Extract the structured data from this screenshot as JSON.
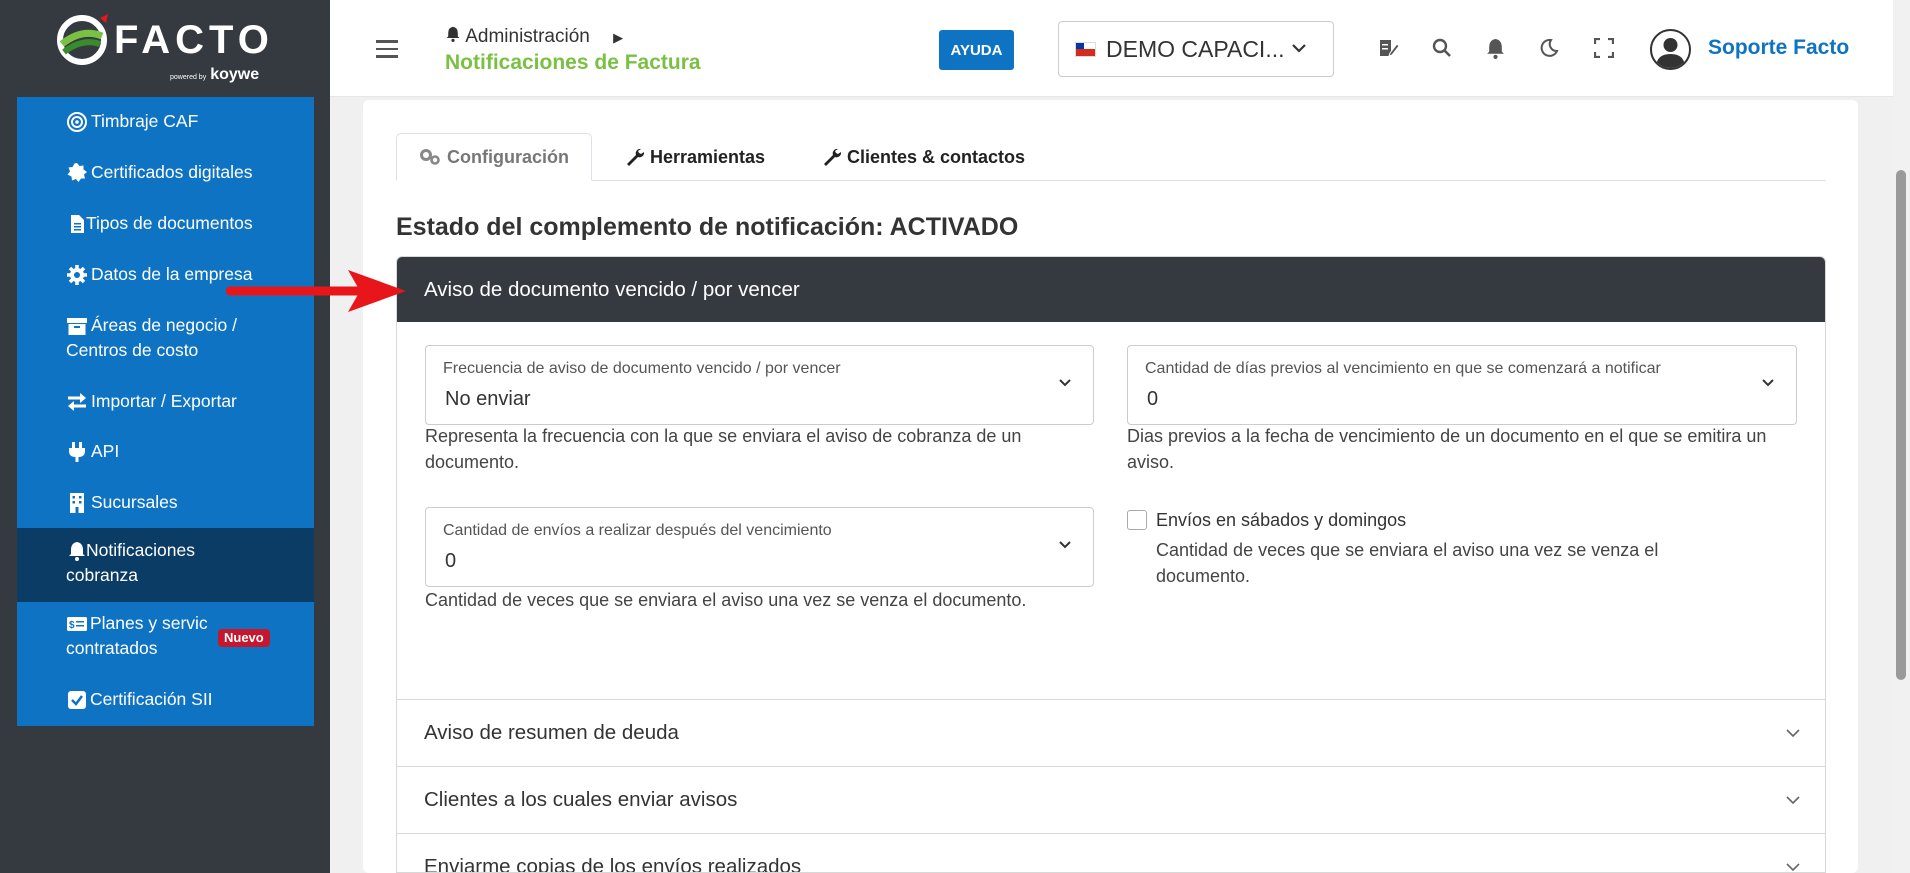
{
  "brand": {
    "name": "FACTO",
    "powered_small": "powered by",
    "powered": "koywe"
  },
  "sidebar": {
    "items": [
      {
        "label": "Timbraje CAF",
        "icon": "target-icon"
      },
      {
        "label": "Certificados digitales",
        "icon": "seal-icon"
      },
      {
        "label": "Tipos de documentos",
        "icon": "file-icon"
      },
      {
        "label": "Datos de la empresa",
        "icon": "gear-icon"
      },
      {
        "label": "Áreas de negocio /",
        "label2": "Centros de costo",
        "icon": "archive-icon"
      },
      {
        "label": "Importar / Exportar",
        "icon": "exchange-icon"
      },
      {
        "label": "API",
        "icon": "plug-icon"
      },
      {
        "label": "Sucursales",
        "icon": "building-icon"
      },
      {
        "label": "Notificaciones",
        "label2": "cobranza",
        "icon": "bell-icon",
        "active": true
      },
      {
        "label": "Planes y servic",
        "label2": "contratados",
        "icon": "money-icon",
        "badge": "Nuevo"
      },
      {
        "label": "Certificación SII",
        "icon": "check-square-icon"
      }
    ]
  },
  "header": {
    "breadcrumb_parent": "Administración",
    "page_title": "Notificaciones de Factura",
    "help_label": "AYUDA",
    "company": "DEMO CAPACI...",
    "user_name": "Soporte Facto"
  },
  "tabs": [
    {
      "label": "Configuración",
      "active": true
    },
    {
      "label": "Herramientas"
    },
    {
      "label": "Clientes & contactos"
    }
  ],
  "status_heading": "Estado del complemento de notificación: ACTIVADO",
  "panel": {
    "title": "Aviso de documento vencido / por vencer",
    "freq": {
      "label": "Frecuencia de aviso de documento vencido / por vencer",
      "value": "No enviar",
      "help": "Representa la frecuencia con la que se enviara el aviso de cobranza de un documento."
    },
    "days_before": {
      "label": "Cantidad de días previos al vencimiento en que se comenzará a notificar",
      "value": "0",
      "help": "Dias previos a la fecha de vencimiento de un documento en el que se emitira un aviso."
    },
    "sends_after": {
      "label": "Cantidad de envíos a realizar después del vencimiento",
      "value": "0",
      "help": "Cantidad de veces que se enviara el aviso una vez se venza el documento."
    },
    "weekends": {
      "label": "Envíos en sábados y domingos",
      "help": "Cantidad de veces que se enviara el aviso una vez se venza el documento.",
      "checked": false
    }
  },
  "accordion": [
    {
      "label": "Aviso de resumen de deuda"
    },
    {
      "label": "Clientes a los cuales enviar avisos"
    },
    {
      "label": "Enviarme copias de los envíos realizados"
    }
  ],
  "colors": {
    "sidebar_bg": "#343a40",
    "nav_blue": "#0f73c3",
    "nav_active": "#0a3c66",
    "title_green": "#7ac143",
    "badge_red": "#c5172d",
    "annotation_red": "#e8161b"
  }
}
